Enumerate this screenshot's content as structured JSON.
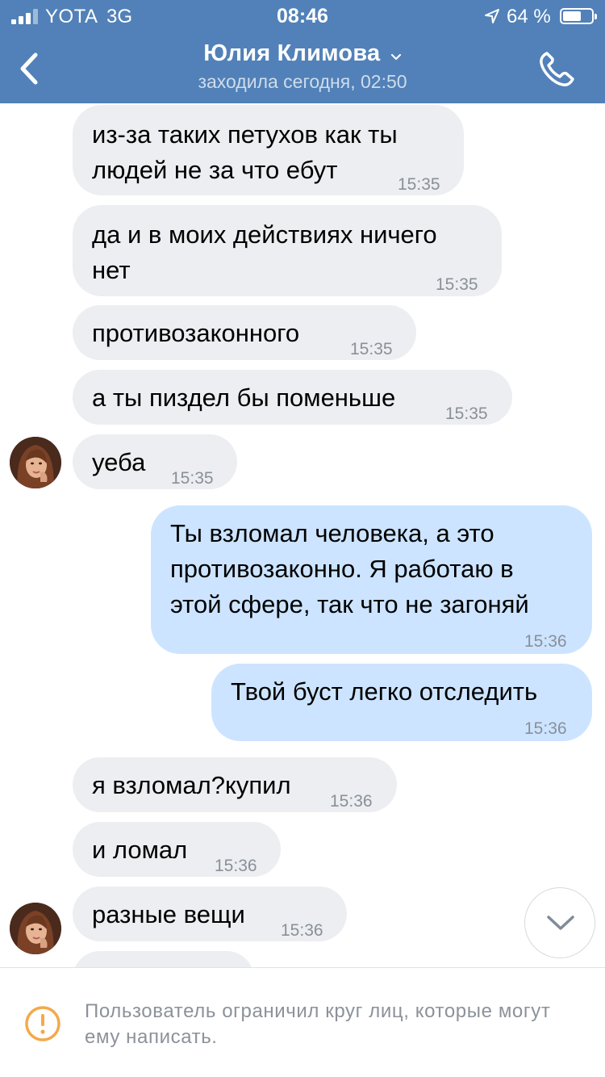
{
  "status_bar": {
    "carrier": "YOTA",
    "network": "3G",
    "time": "08:46",
    "battery": "64 %",
    "battery_level": 0.64
  },
  "header": {
    "contact_name": "Юлия Климова",
    "last_seen": "заходила сегодня, 02:50",
    "back_icon": "chevron-left-icon",
    "call_icon": "phone-icon"
  },
  "messages": [
    {
      "dir": "in",
      "lines": [
        "из-за таких петухов как ты",
        "людей не за что ебут"
      ],
      "time": "15:35"
    },
    {
      "dir": "in",
      "lines": [
        "да и в моих действиях ничего",
        "нет"
      ],
      "time": "15:35"
    },
    {
      "dir": "in",
      "lines": [
        "противозаконного"
      ],
      "time": "15:35"
    },
    {
      "dir": "in",
      "lines": [
        "а ты пиздел бы поменьше"
      ],
      "time": "15:35"
    },
    {
      "dir": "in",
      "lines": [
        "уеба"
      ],
      "time": "15:35"
    },
    {
      "dir": "out",
      "lines": [
        "Ты взломал человека, а это",
        "противозаконно. Я работаю в",
        "этой сфере, так что не загоняй"
      ],
      "time": "15:36"
    },
    {
      "dir": "out",
      "lines": [
        "Твой буст легко отследить"
      ],
      "time": "15:36"
    },
    {
      "dir": "in",
      "lines": [
        "я взломал?купил"
      ],
      "time": "15:36"
    },
    {
      "dir": "in",
      "lines": [
        "и ломал"
      ],
      "time": "15:36"
    },
    {
      "dir": "in",
      "lines": [
        "разные вещи"
      ],
      "time": "15:36"
    }
  ],
  "notice": {
    "text": "Пользователь ограничил круг лиц, которые могут ему написать.",
    "icon": "warning-icon",
    "icon_color": "#f4a94a"
  },
  "colors": {
    "header": "#5181b8",
    "incoming_bubble": "#eceef1",
    "outgoing_bubble": "#cce4ff"
  }
}
